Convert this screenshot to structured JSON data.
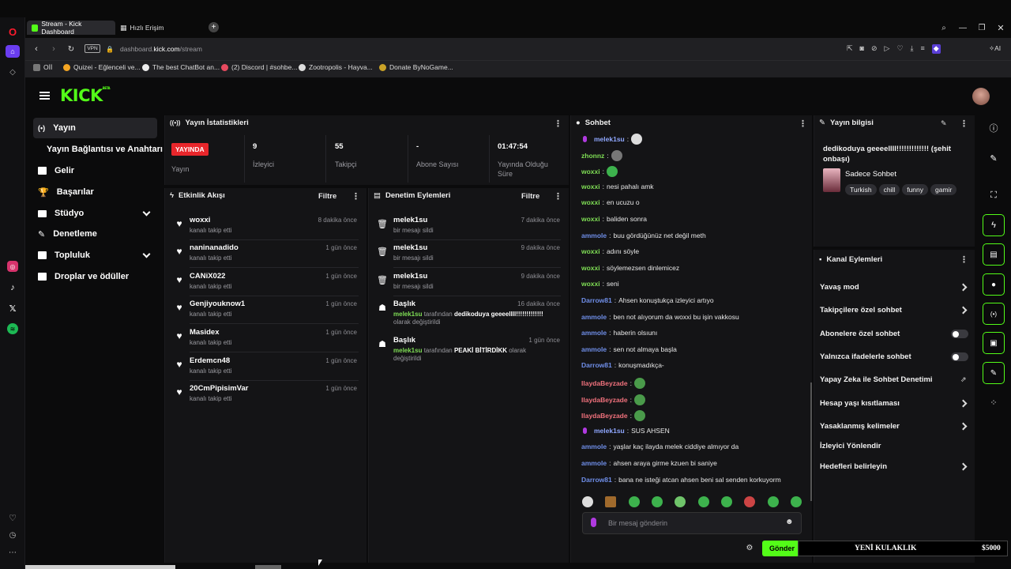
{
  "browser": {
    "tabs": [
      {
        "label": "Stream - Kick Dashboard"
      },
      {
        "label": "Hızlı Erişim"
      }
    ],
    "url": {
      "host": "dashboard.",
      "domain": "kick.com",
      "path": "/stream"
    },
    "vpn_label": "VPN",
    "ai_label": "AI",
    "bookmarks": [
      {
        "label": "Oİİ"
      },
      {
        "label": "Quizei - Eğlenceli ve..."
      },
      {
        "label": "The best ChatBot an..."
      },
      {
        "label": "(2) Discord | #sohbe..."
      },
      {
        "label": "Zootropolis - Hayva..."
      },
      {
        "label": "Donate ByNoGame..."
      }
    ]
  },
  "app": {
    "logo": "KICK",
    "logo_sup": "BETA"
  },
  "nav": {
    "items": [
      {
        "label": "Yayın"
      },
      {
        "label": "Yayın Bağlantısı ve Anahtarı"
      },
      {
        "label": "Gelir"
      },
      {
        "label": "Başarılar"
      },
      {
        "label": "Stüdyo"
      },
      {
        "label": "Denetleme"
      },
      {
        "label": "Topluluk"
      },
      {
        "label": "Droplar ve ödüller"
      }
    ]
  },
  "stats": {
    "title": "Yayın İstatistikleri",
    "live_badge": "YAYINDA",
    "live_label": "Yayın",
    "items": [
      {
        "value": "9",
        "label": "İzleyici"
      },
      {
        "value": "55",
        "label": "Takipçi"
      },
      {
        "value": "-",
        "label": "Abone Sayısı"
      },
      {
        "value": "01:47:54",
        "label": "Yayında Olduğu Süre"
      }
    ]
  },
  "activity": {
    "title": "Etkinlik Akışı",
    "filter": "Filtre",
    "rows": [
      {
        "name": "woxxi",
        "sub": "kanalı takip etti",
        "time": "8 dakika önce"
      },
      {
        "name": "naninanadido",
        "sub": "kanalı takip etti",
        "time": "1 gün önce"
      },
      {
        "name": "CANiX022",
        "sub": "kanalı takip etti",
        "time": "1 gün önce"
      },
      {
        "name": "Genjiyouknow1",
        "sub": "kanalı takip etti",
        "time": "1 gün önce"
      },
      {
        "name": "Masidex",
        "sub": "kanalı takip etti",
        "time": "1 gün önce"
      },
      {
        "name": "Erdemcn48",
        "sub": "kanalı takip etti",
        "time": "1 gün önce"
      },
      {
        "name": "20CmPipisimVar",
        "sub": "kanalı takip etti",
        "time": "1 gün önce"
      }
    ]
  },
  "moderation": {
    "title": "Denetim Eylemleri",
    "filter": "Filtre",
    "rows": [
      {
        "name": "melek1su",
        "sub": "bir mesajı sildi",
        "time": "7 dakika önce"
      },
      {
        "name": "melek1su",
        "sub": "bir mesajı sildi",
        "time": "9 dakika önce"
      },
      {
        "name": "melek1su",
        "sub": "bir mesajı sildi",
        "time": "9 dakika önce"
      },
      {
        "name": "Başlık",
        "user": "melek1su",
        "mid": " tarafından ",
        "value": "dedikoduya geeeellll!!!!!!!!!!!!!",
        "end": " olarak değiştirildi",
        "time": "16 dakika önce"
      },
      {
        "name": "Başlık",
        "user": "melek1su",
        "mid": " tarafından ",
        "value": "PEAKİ BİTİRDİKK",
        "end": " olarak değiştirildi",
        "time": "1 gün önce"
      }
    ]
  },
  "chat": {
    "title": "Sohbet",
    "placeholder": "Bir mesaj gönderin",
    "send": "Gönder",
    "messages": [
      {
        "user": "melek1su",
        "text": ""
      },
      {
        "user": "zhonnz",
        "text": ""
      },
      {
        "user": "woxxi",
        "text": ""
      },
      {
        "user": "woxxi",
        "text": "nesi pahalı amk"
      },
      {
        "user": "woxxi",
        "text": "en ucuzu o"
      },
      {
        "user": "woxxi",
        "text": "baliden sonra"
      },
      {
        "user": "ammole",
        "text": "buu gördüğünüz net değil meth"
      },
      {
        "user": "woxxi",
        "text": "adını söyle"
      },
      {
        "user": "woxxi",
        "text": "söylemezsen dinlemicez"
      },
      {
        "user": "woxxi",
        "text": "seni"
      },
      {
        "user": "Darrow81",
        "text": "Ahsen konuştukça izleyici artıyo"
      },
      {
        "user": "ammole",
        "text": "ben not alıyorum da woxxi bu işin vakkosu"
      },
      {
        "user": "ammole",
        "text": "haberin olsıunı"
      },
      {
        "user": "ammole",
        "text": "sen not almaya başla"
      },
      {
        "user": "Darrow81",
        "text": "konuşmadıkça-"
      },
      {
        "user": "IlaydaBeyzade",
        "text": ""
      },
      {
        "user": "IlaydaBeyzade",
        "text": ""
      },
      {
        "user": "IlaydaBeyzade",
        "text": ""
      },
      {
        "user": "melek1su",
        "text": "SUS AHSEN"
      },
      {
        "user": "ammole",
        "text": "yaşlar kaç ilayda melek ciddiye almıyor da"
      },
      {
        "user": "ammole",
        "text": "ahsen araya girme kzuen bi saniye"
      },
      {
        "user": "Darrow81",
        "text": "bana ne isteği atcan ahsen beni sal senden korkuyorm"
      }
    ]
  },
  "stream_info": {
    "title": "Yayın bilgisi",
    "stream_title": "dedikoduya geeeellll!!!!!!!!!!!!! (şehit onbaşı)",
    "category": "Sadece Sohbet",
    "tags": [
      "Turkish",
      "chill",
      "funny",
      "gamir"
    ]
  },
  "channel_actions": {
    "title": "Kanal Eylemleri",
    "items": [
      {
        "label": "Yavaş mod"
      },
      {
        "label": "Takipçilere özel sohbet"
      },
      {
        "label": "Abonelere özel sohbet"
      },
      {
        "label": "Yalnızca ifadelerle sohbet"
      },
      {
        "label": "Yapay Zeka ile Sohbet Denetimi"
      },
      {
        "label": "Hesap yaşı kısıtlaması"
      },
      {
        "label": "Yasaklanmış kelimeler"
      },
      {
        "label": "İzleyici Yönlendir"
      },
      {
        "label": "Hedefleri belirleyin"
      }
    ]
  },
  "overlay": {
    "text": "YENİ KULAKLIK",
    "amount": "$5000"
  },
  "colors": {
    "brand": "#53fc18",
    "live": "#e8262b",
    "panel": "#141416",
    "bg": "#0b0b0c"
  }
}
